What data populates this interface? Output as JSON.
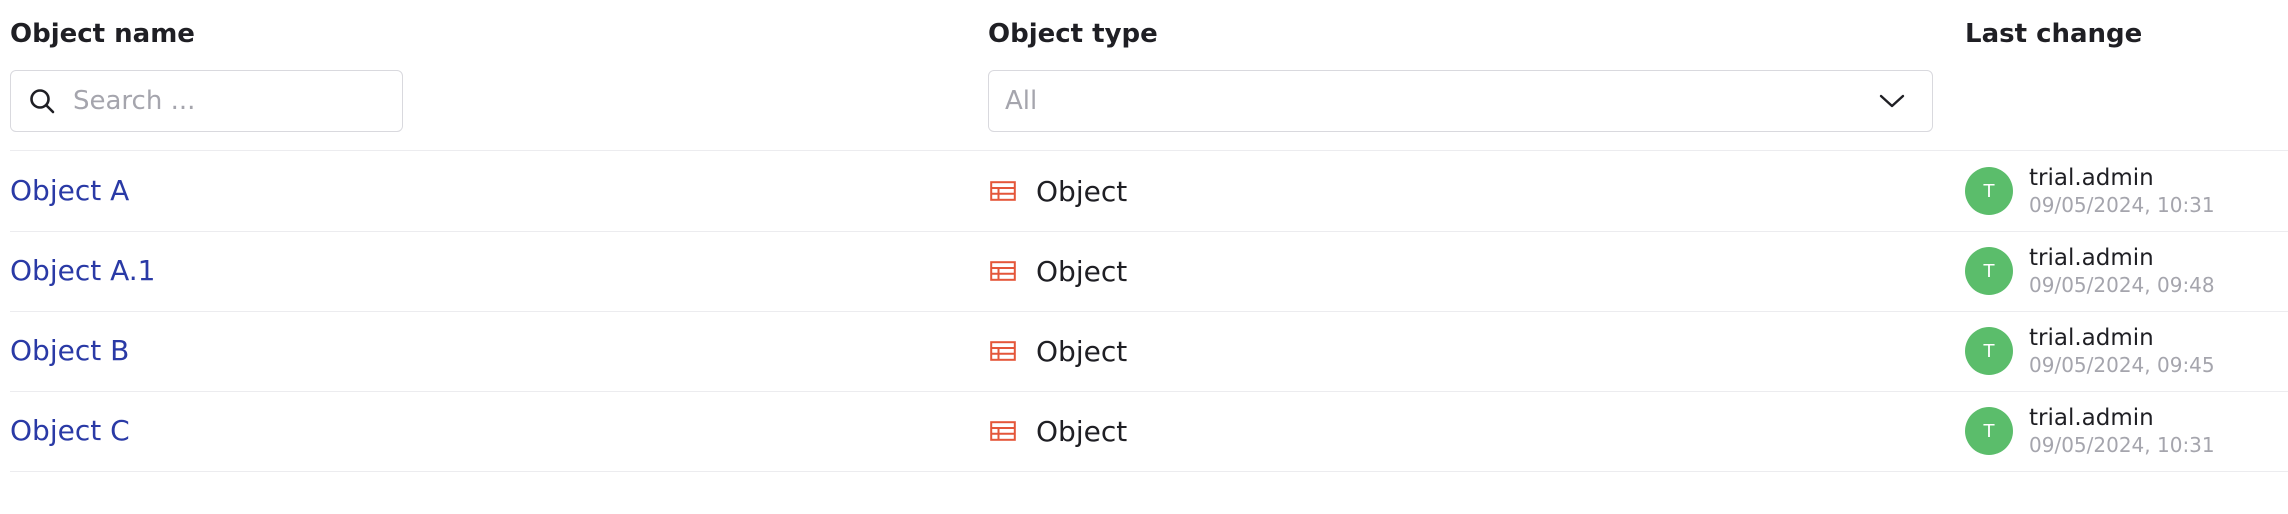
{
  "header": {
    "name_label": "Object name",
    "type_label": "Object type",
    "change_label": "Last change"
  },
  "search": {
    "placeholder": "Search ...",
    "value": ""
  },
  "type_filter": {
    "selected": "All"
  },
  "icons": {
    "search": "search-icon",
    "dropdown": "chevron-down-icon",
    "object": "table-object-icon"
  },
  "colors": {
    "link": "#2a3aa6",
    "object_icon": "#e4563a",
    "avatar": "#5bbd6b"
  },
  "rows": [
    {
      "name": "Object A",
      "type": "Object",
      "avatar_initial": "T",
      "user": "trial.admin",
      "date": "09/05/2024, 10:31"
    },
    {
      "name": "Object A.1",
      "type": "Object",
      "avatar_initial": "T",
      "user": "trial.admin",
      "date": "09/05/2024, 09:48"
    },
    {
      "name": "Object B",
      "type": "Object",
      "avatar_initial": "T",
      "user": "trial.admin",
      "date": "09/05/2024, 09:45"
    },
    {
      "name": "Object C",
      "type": "Object",
      "avatar_initial": "T",
      "user": "trial.admin",
      "date": "09/05/2024, 10:31"
    }
  ]
}
